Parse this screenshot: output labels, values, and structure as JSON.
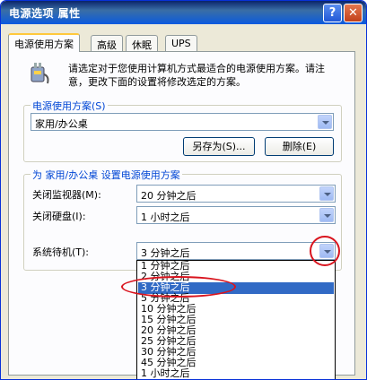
{
  "window": {
    "title": "电源选项 属性",
    "help_glyph": "?",
    "close_glyph": "✕"
  },
  "tabs": [
    {
      "label": "电源使用方案",
      "active": true
    },
    {
      "label": "高级",
      "active": false
    },
    {
      "label": "休眠",
      "active": false
    },
    {
      "label": "UPS",
      "active": false
    }
  ],
  "description": "请选定对于您使用计算机方式最适合的电源使用方案。请注意，更改下面的设置将修改选定的方案。",
  "scheme_group": {
    "label": "电源使用方案(S)",
    "selected": "家用/办公桌",
    "save_as_button": "另存为(S)...",
    "delete_button": "删除(E)"
  },
  "settings_group": {
    "label": "为 家用/办公桌 设置电源使用方案",
    "monitor_label": "关闭监视器(M):",
    "monitor_value": "20 分钟之后",
    "harddisk_label": "关闭硬盘(I):",
    "harddisk_value": "1 小时之后",
    "standby_label": "系统待机(T):",
    "standby_value": "3 分钟之后"
  },
  "standby_dropdown": {
    "options": [
      "1 分钟之后",
      "2 分钟之后",
      "3 分钟之后",
      "5 分钟之后",
      "10 分钟之后",
      "15 分钟之后",
      "20 分钟之后",
      "25 分钟之后",
      "30 分钟之后",
      "45 分钟之后",
      "1 小时之后"
    ],
    "selected_index": 2
  },
  "colors": {
    "title_bar": "#0a5adf",
    "group_label": "#0046d5",
    "selection": "#316ac5",
    "annotation": "#d9141e"
  }
}
